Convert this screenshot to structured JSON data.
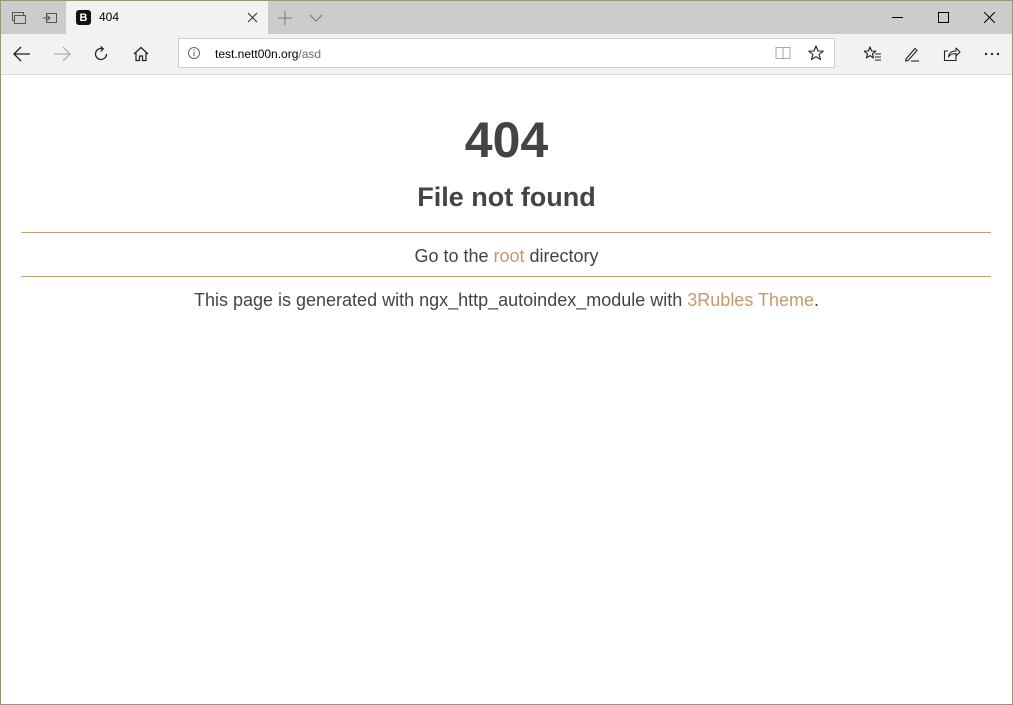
{
  "browser": {
    "tab": {
      "favicon_letter": "B",
      "title": "404"
    },
    "address": {
      "host": "test.nett00n.org",
      "path": "/asd"
    },
    "icons": {
      "set_aside": "tabs-aside-icon",
      "show_tabs": "show-aside-tabs-icon",
      "tab_close": "close-icon",
      "new_tab": "plus-icon",
      "tab_preview": "chevron-down-icon",
      "minimize": "minimize-icon",
      "maximize": "maximize-icon",
      "close": "close-icon",
      "back": "back-arrow-icon",
      "forward": "forward-arrow-icon",
      "refresh": "refresh-icon",
      "home": "home-icon",
      "site_info": "info-icon",
      "reading_view": "reading-view-icon",
      "favorite": "star-icon",
      "favorites_hub": "favorites-hub-icon",
      "web_note": "pen-icon",
      "share": "share-icon",
      "more": "more-icon"
    }
  },
  "page": {
    "code": "404",
    "heading": "File not found",
    "goto": {
      "prefix": "Go to the ",
      "link": "root",
      "suffix": " directory"
    },
    "footer": {
      "prefix": "This page is generated with ngx_http_autoindex_module with ",
      "link": "3Rubles Theme",
      "suffix": "."
    },
    "colors": {
      "text": "#444444",
      "link": "#c8976a",
      "rule": "#c8a070"
    }
  }
}
